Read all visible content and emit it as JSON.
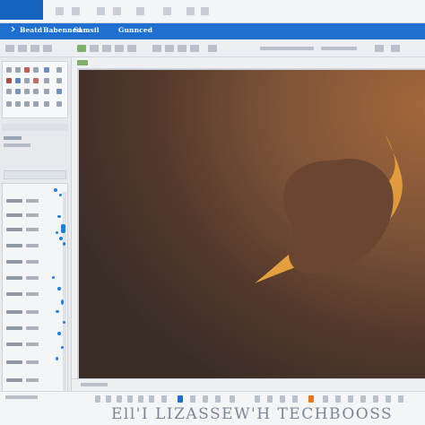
{
  "menu": {
    "items": [
      {
        "label": "Beatd"
      },
      {
        "label": "Babenned"
      },
      {
        "label": "Samsil"
      },
      {
        "label": "Gunnced"
      }
    ]
  },
  "canvas": {
    "background_colors": [
      "#a3673a",
      "#553a2c",
      "#3a2d28"
    ],
    "flame_colors": [
      "#f2b54c",
      "#6a4530"
    ]
  },
  "status": {
    "bottom_text": "Ell'I LIZASSEW'H TECHBOOSS"
  },
  "colors": {
    "accent": "#1e6fd0",
    "accent_dark": "#1565c0",
    "dot_blue": "#1a7fe0",
    "swatch_orange": "#e6761f"
  },
  "icons": [
    "close-icon",
    "minimize-icon",
    "maximize-icon",
    "move-icon",
    "brush-icon",
    "eraser-icon",
    "crop-icon",
    "zoom-icon",
    "layers-icon",
    "scroll-thumb-icon"
  ]
}
